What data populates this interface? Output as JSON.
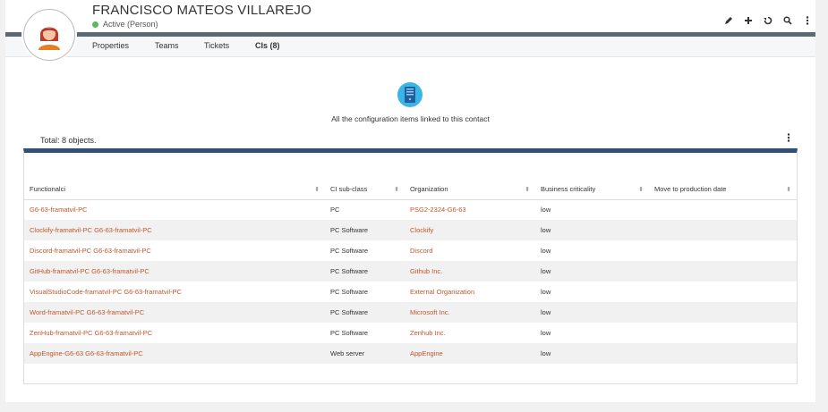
{
  "person": {
    "name": "FRANCISCO MATEOS VILLAREJO",
    "status": "Active (Person)"
  },
  "tabs": [
    {
      "label": "Properties"
    },
    {
      "label": "Teams"
    },
    {
      "label": "Tickets"
    },
    {
      "label": "CIs (8)"
    }
  ],
  "empty": {
    "text": "All the configuration items linked to this contact"
  },
  "total": "Total: 8 objects.",
  "table": {
    "columns": [
      "Functionalci",
      "CI sub-class",
      "Organization",
      "Business criticality",
      "Move to production date"
    ],
    "rows": [
      [
        "G6-63-framatvil-PC",
        "PC",
        "PSG2-2324-G6-63",
        "low",
        ""
      ],
      [
        "Clockify-framatvil-PC G6-63-framatvil-PC",
        "PC Software",
        "Clockify",
        "low",
        ""
      ],
      [
        "Discord-framatvil-PC G6-63-framatvil-PC",
        "PC Software",
        "Discord",
        "low",
        ""
      ],
      [
        "GitHub-framatvil-PC G6-63-framatvil-PC",
        "PC Software",
        "Github Inc.",
        "low",
        ""
      ],
      [
        "VisualStudioCode-framatvil-PC G6-63-framatvil-PC",
        "PC Software",
        "External Organization",
        "low",
        ""
      ],
      [
        "Word-framatvil-PC G6-63-framatvil-PC",
        "PC Software",
        "Microsoft Inc.",
        "low",
        ""
      ],
      [
        "ZenHub-framatvil-PC G6-63-framatvil-PC",
        "PC Software",
        "Zenhub Inc.",
        "low",
        ""
      ],
      [
        "AppEngine-G6-63 G6-63-framatvil-PC",
        "Web server",
        "AppEngine",
        "low",
        ""
      ]
    ]
  },
  "colors": {
    "accent_link": "#c0562b",
    "table_top_bar": "#2f5173",
    "header_band": "#5a6a70",
    "status_active": "#5cb85c",
    "empty_icon_bg": "#3bb5e8"
  }
}
